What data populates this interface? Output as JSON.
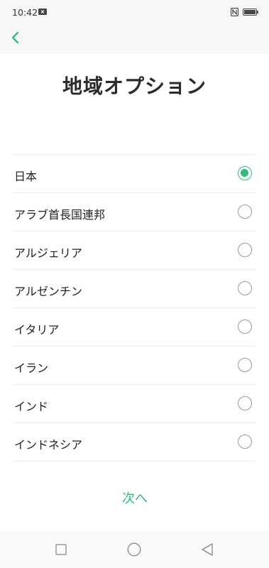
{
  "status_bar": {
    "time": "10:42"
  },
  "header": {
    "title": "地域オプション"
  },
  "regions": [
    {
      "label": "日本",
      "selected": true
    },
    {
      "label": "アラブ首長国連邦",
      "selected": false
    },
    {
      "label": "アルジェリア",
      "selected": false
    },
    {
      "label": "アルゼンチン",
      "selected": false
    },
    {
      "label": "イタリア",
      "selected": false
    },
    {
      "label": "イラン",
      "selected": false
    },
    {
      "label": "インド",
      "selected": false
    },
    {
      "label": "インドネシア",
      "selected": false
    }
  ],
  "footer": {
    "next_label": "次へ"
  },
  "colors": {
    "accent": "#2ebd7c"
  },
  "icons": [
    "sim-icon",
    "nfc-icon",
    "battery-icon",
    "back-arrow-icon",
    "recent-apps-icon",
    "home-icon",
    "nav-back-icon"
  ]
}
